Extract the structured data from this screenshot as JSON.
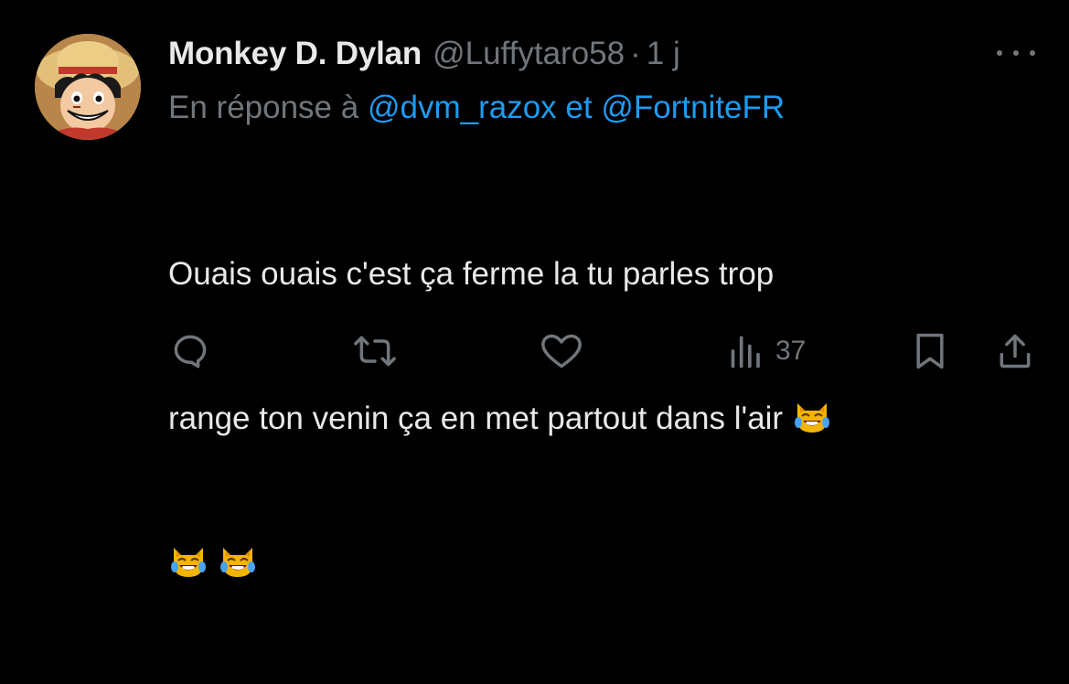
{
  "tweet": {
    "author": {
      "display_name": "Monkey D. Dylan",
      "handle": "@Luffytaro58",
      "separator": "·",
      "time": "1 j",
      "avatar_icon": "luffy-avatar"
    },
    "reply": {
      "prefix": "En réponse à",
      "mention1": "@dvm_razox",
      "conjunction": "et",
      "mention2": "@FortniteFR"
    },
    "body": {
      "line1": "Ouais ouais c'est ça ferme la tu parles trop",
      "line2": "range ton venin ça en met partout dans l'air",
      "emoji": "cat-with-tears-of-joy"
    },
    "actions": {
      "reply_icon": "reply-icon",
      "retweet_icon": "retweet-icon",
      "like_icon": "heart-icon",
      "views_icon": "views-icon",
      "views_count": "37",
      "bookmark_icon": "bookmark-icon",
      "share_icon": "share-icon"
    },
    "colors": {
      "background": "#000000",
      "primary_text": "#e7e9ea",
      "secondary_text": "#71767b",
      "link": "#1d9bf0"
    }
  }
}
